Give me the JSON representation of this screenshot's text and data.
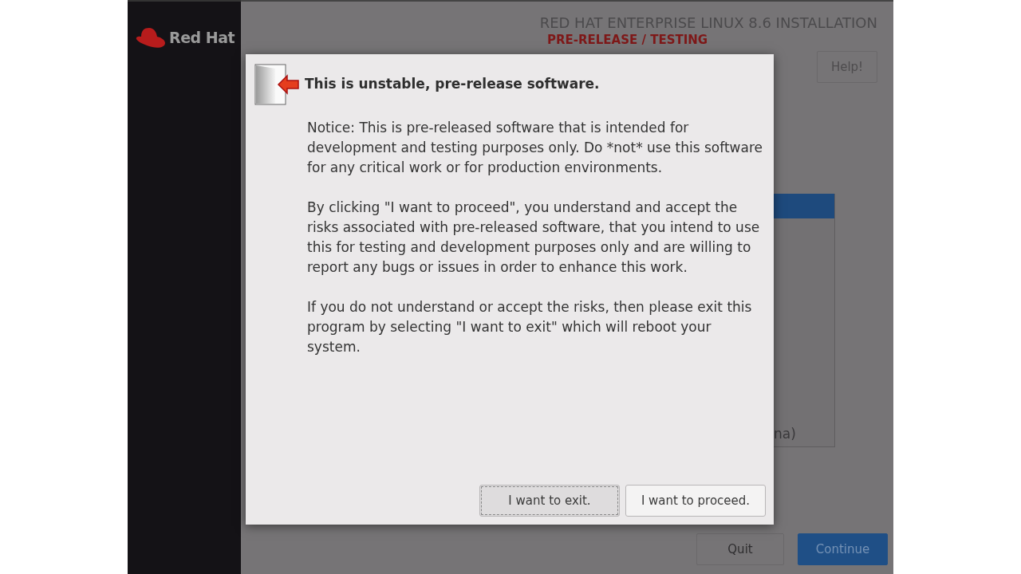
{
  "sidebar": {
    "logo_text": "Red Hat"
  },
  "header": {
    "title": "RED HAT ENTERPRISE LINUX 8.6 INSTALLATION",
    "subtitle": "PRE-RELEASE / TESTING",
    "help_button": "Help!"
  },
  "list": {
    "rows": [
      {
        "selected": true
      },
      {
        "selected": false,
        "text": "na)"
      }
    ]
  },
  "footer": {
    "buttons": [
      {
        "label": "Quit",
        "kind": "secondary"
      },
      {
        "label": "Continue",
        "kind": "primary"
      }
    ]
  },
  "dialog": {
    "title": "This is unstable, pre-release software.",
    "paragraphs": [
      "Notice: This is pre-released software that is intended for development and testing purposes only.  Do *not* use this software for any critical work or for production environments.",
      "By clicking \"I want to proceed\", you understand and accept the risks associated with pre-released software, that you intend to use this for testing and development purposes only and are willing to report any bugs or issues in order to enhance this work.",
      "If you do not understand or accept the risks, then please exit this program by selecting \"I want to exit\" which will reboot your system."
    ],
    "buttons": [
      {
        "label": "I want to exit.",
        "focused": true
      },
      {
        "label": "I want to proceed.",
        "focused": false
      }
    ]
  }
}
